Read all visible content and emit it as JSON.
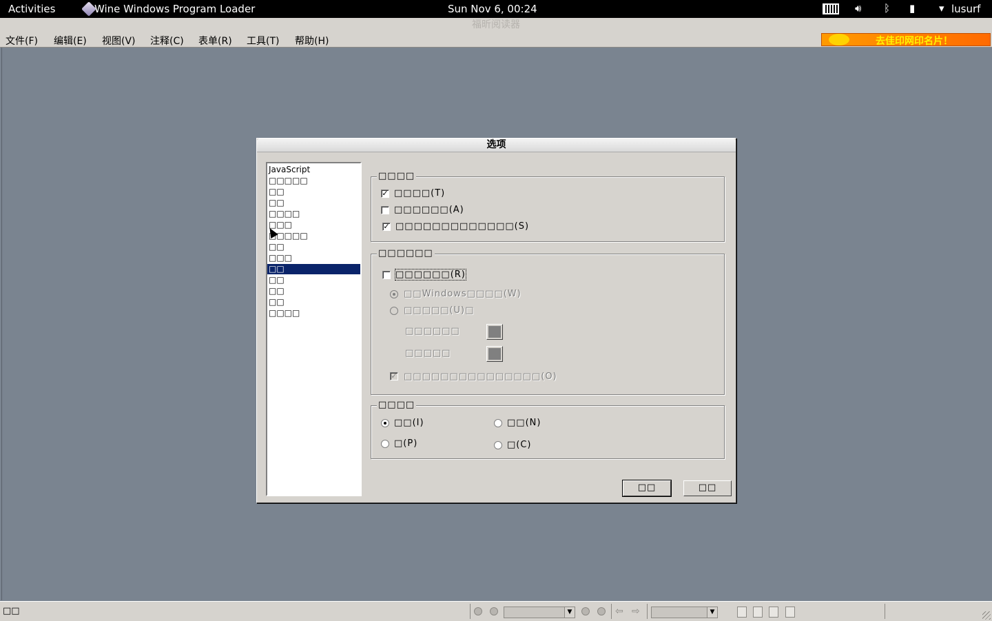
{
  "topbar": {
    "activities": "Activities",
    "app_name": "Wine Windows Program Loader",
    "clock": "Sun Nov  6, 00:24",
    "user": "lusurf"
  },
  "window": {
    "title": "福昕阅读器"
  },
  "menubar": {
    "items": [
      "文件(F)",
      "编辑(E)",
      "视图(V)",
      "注释(C)",
      "表单(R)",
      "工具(T)",
      "帮助(H)"
    ]
  },
  "ad": {
    "text": "去佳印网印名片！"
  },
  "dialog": {
    "title": "选项",
    "categories": [
      "JavaScript",
      "□□□□□",
      "□□",
      "□□",
      "□□□□",
      "□□□",
      "□□□□□",
      "□□",
      "□□□",
      "□□",
      "□□",
      "□□",
      "□□",
      "□□□□"
    ],
    "selected_index": 9,
    "group1": {
      "title": "□□□□",
      "options": [
        {
          "label": "□□□□(T)",
          "checked": true
        },
        {
          "label": "□□□□□□(A)",
          "checked": false
        },
        {
          "label": "□□□□□□□□□□□□□(S)",
          "checked": true
        }
      ]
    },
    "group2": {
      "title": "□□□□□□",
      "main_check": {
        "label": "□□□□□□(R)",
        "checked": false
      },
      "radio_windows": {
        "label": "□□Windows□□□□(W)",
        "selected": true
      },
      "radio_custom": {
        "label": "□□□□□(U)□",
        "selected": false
      },
      "color1_label": "□□□□□□",
      "color2_label": "□□□□□",
      "sub_check": {
        "label": "□□□□□□□□□□□□□□□(O)",
        "checked": true
      }
    },
    "group3": {
      "title": "□□□□",
      "options": [
        {
          "label": "□□(I)",
          "selected": true
        },
        {
          "label": "□□(N)",
          "selected": false
        },
        {
          "label": "□(P)",
          "selected": false
        },
        {
          "label": "□(C)",
          "selected": false
        }
      ]
    },
    "ok_label": "□□",
    "cancel_label": "□□"
  },
  "statusbar": {
    "text": "□□"
  }
}
